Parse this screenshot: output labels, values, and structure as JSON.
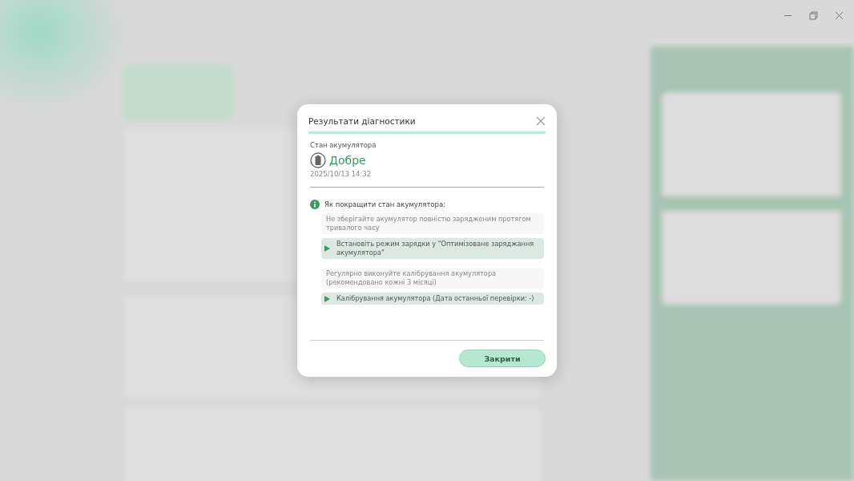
{
  "window_controls": [
    {
      "kind": "minimize"
    },
    {
      "kind": "restore"
    },
    {
      "kind": "close"
    }
  ],
  "dialog": {
    "title": "Результати діагностики",
    "status": {
      "label": "Стан акумулятора",
      "value": "Добре",
      "timestamp": "2025/10/13 14:32"
    },
    "tips_heading": "Як покращити стан акумулятора:",
    "tips": [
      {
        "kind": "note",
        "text": "Не зберігайте акумулятор повністю зарядженим протягом тривалого часу"
      },
      {
        "kind": "action",
        "text": "Встановіть режим зарядки у \"Оптимізоване заряджання акумулятора\""
      },
      {
        "kind": "note",
        "text": "Регулярно виконуйте калібрування акумулятора (рекомендовано кожні 3 місяці)"
      },
      {
        "kind": "action",
        "text": "Калібрування акумулятора (Дата останньої перевірки: -)"
      }
    ],
    "button": "Закрити"
  }
}
